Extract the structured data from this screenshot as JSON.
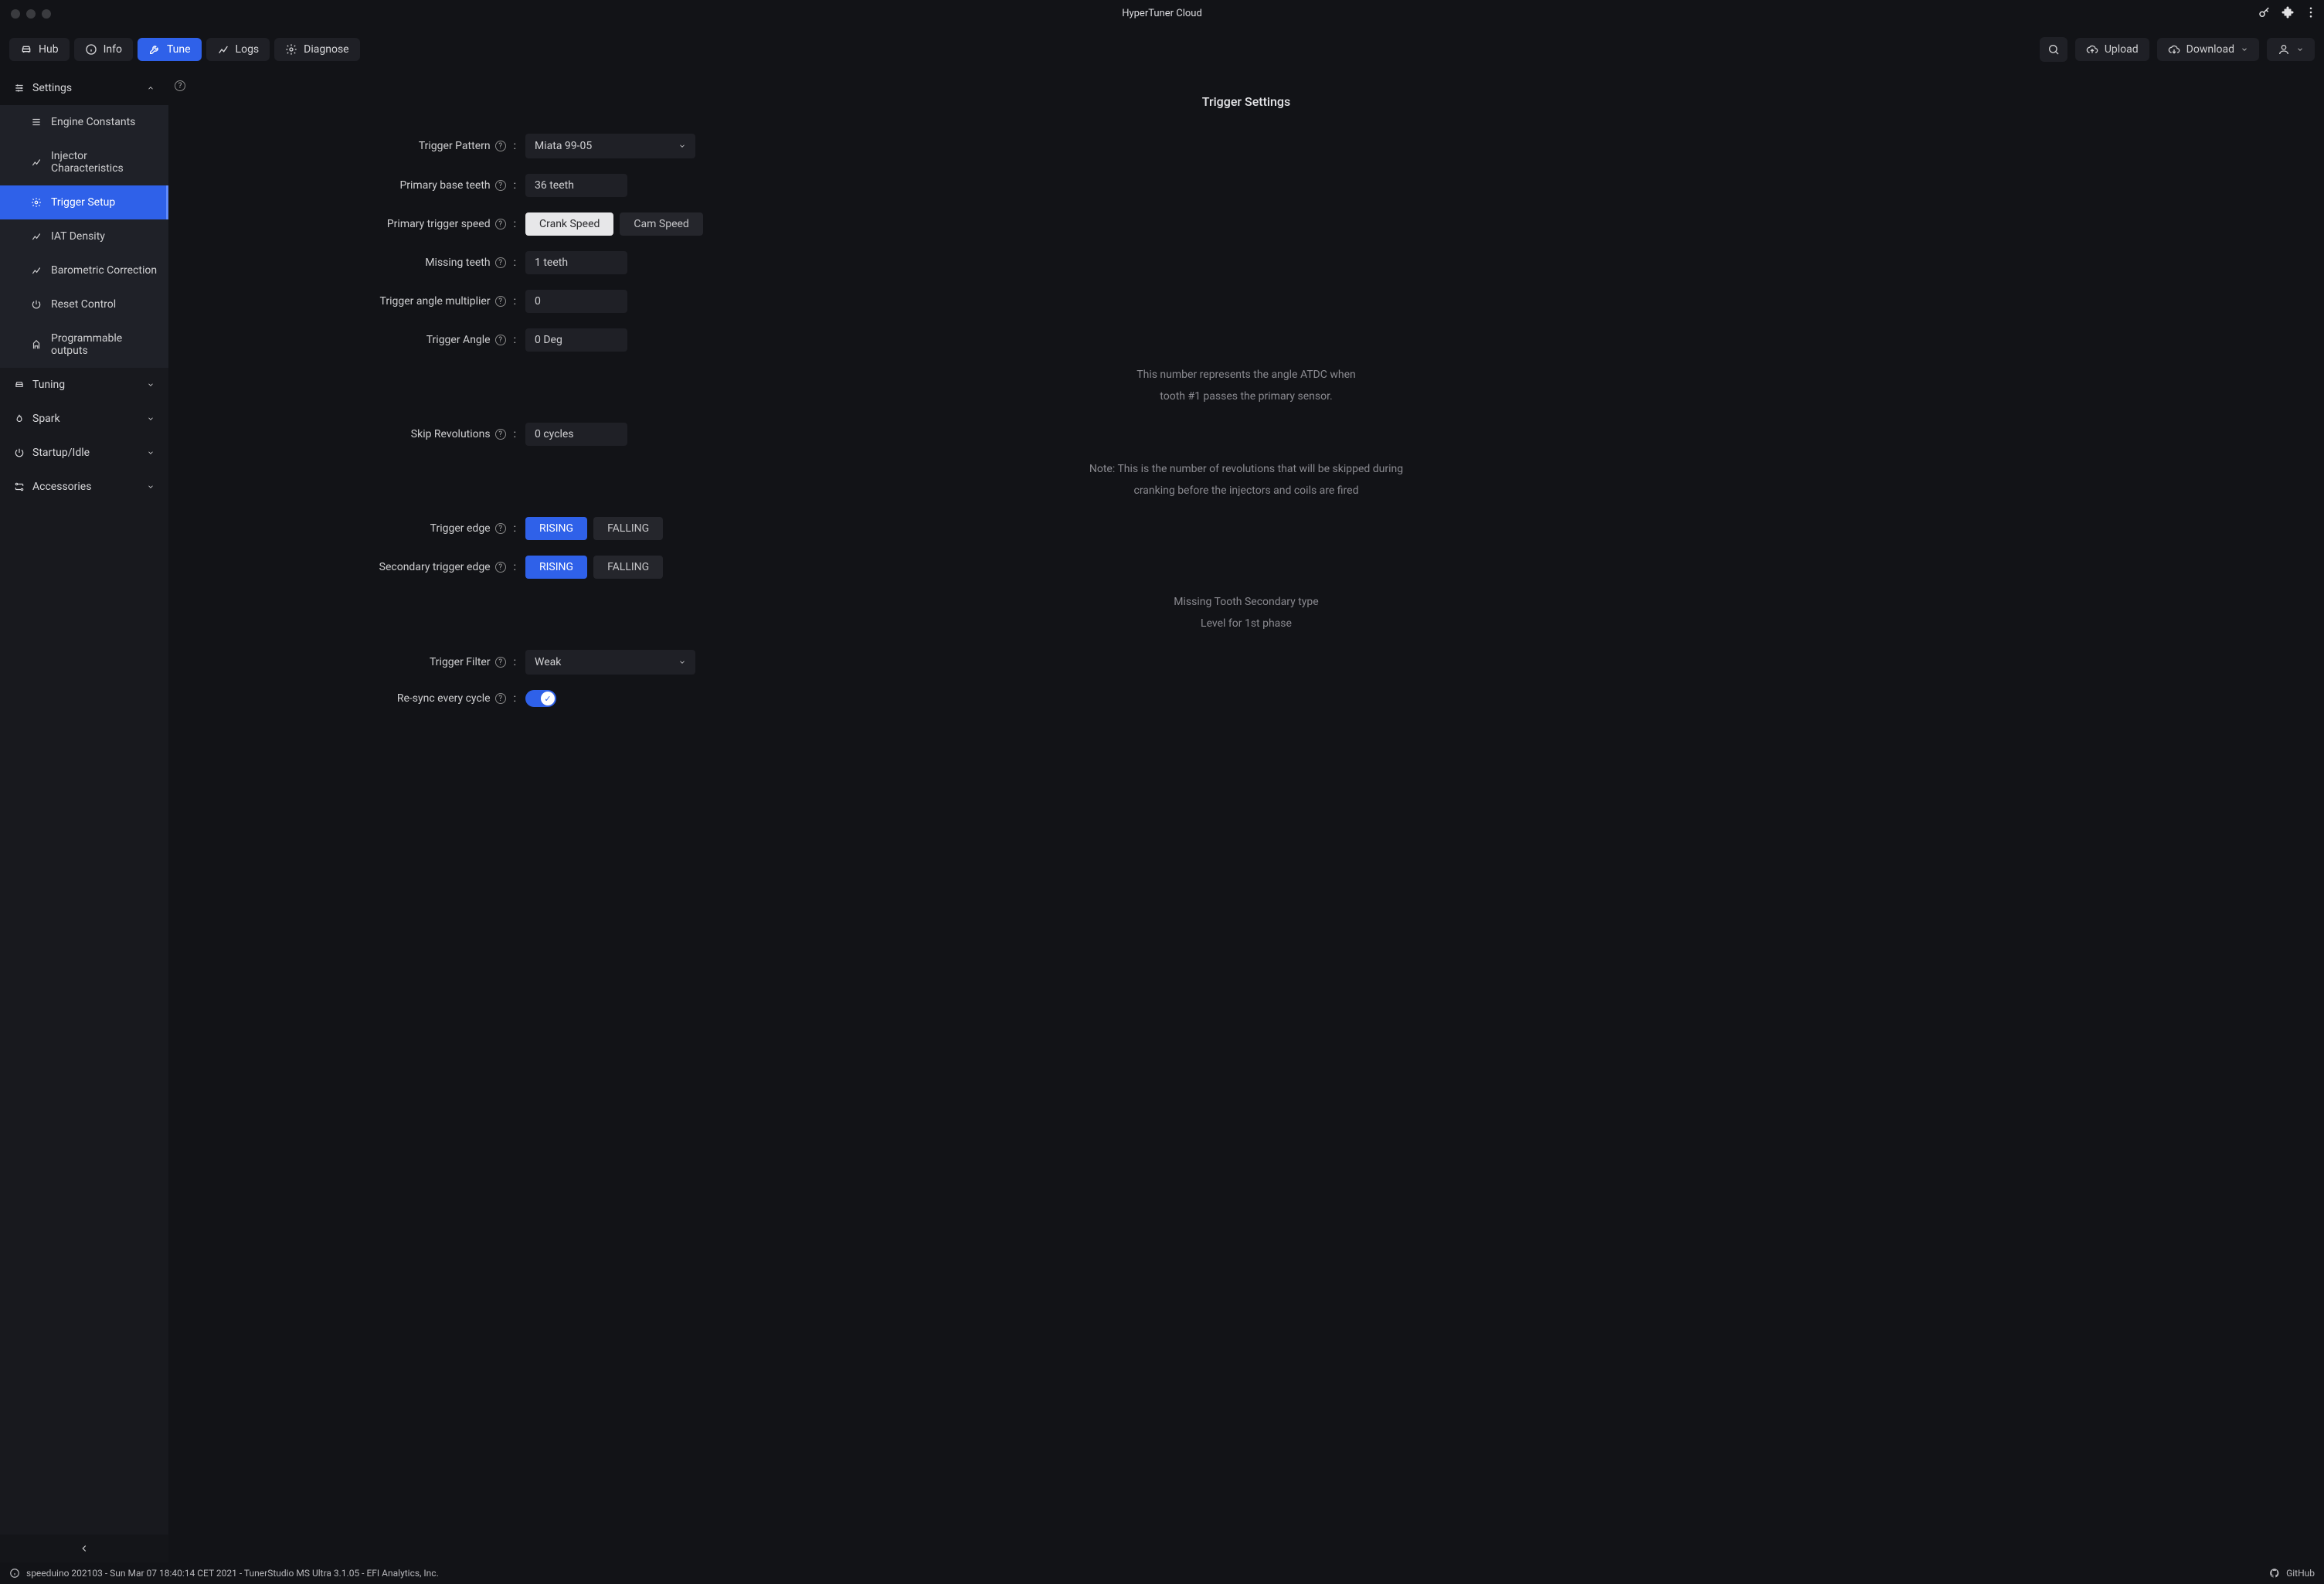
{
  "app_title": "HyperTuner Cloud",
  "nav_tabs": {
    "hub": "Hub",
    "info": "Info",
    "tune": "Tune",
    "logs": "Logs",
    "diagnose": "Diagnose"
  },
  "toolbar": {
    "upload": "Upload",
    "download": "Download"
  },
  "sidebar": {
    "settings": "Settings",
    "engine_constants": "Engine Constants",
    "injector_characteristics": "Injector Characteristics",
    "trigger_setup": "Trigger Setup",
    "iat_density": "IAT Density",
    "barometric_correction": "Barometric Correction",
    "reset_control": "Reset Control",
    "programmable_outputs": "Programmable outputs",
    "tuning": "Tuning",
    "spark": "Spark",
    "startup_idle": "Startup/Idle",
    "accessories": "Accessories"
  },
  "page": {
    "title": "Trigger Settings",
    "rows": {
      "trigger_pattern": {
        "label": "Trigger Pattern",
        "value": "Miata 99-05"
      },
      "primary_base_teeth": {
        "label": "Primary base teeth",
        "value": "36 teeth"
      },
      "primary_trigger_speed": {
        "label": "Primary trigger speed",
        "opt_a": "Crank Speed",
        "opt_b": "Cam Speed"
      },
      "missing_teeth": {
        "label": "Missing teeth",
        "value": "1 teeth"
      },
      "trigger_angle_multiplier": {
        "label": "Trigger angle multiplier",
        "value": "0"
      },
      "trigger_angle": {
        "label": "Trigger Angle",
        "value": "0 Deg",
        "desc1": "This number represents the angle ATDC when",
        "desc2": "tooth #1 passes the primary sensor."
      },
      "skip_revolutions": {
        "label": "Skip Revolutions",
        "value": "0 cycles",
        "desc1": "Note: This is the number of revolutions that will be skipped during",
        "desc2": "cranking before the injectors and coils are fired"
      },
      "trigger_edge": {
        "label": "Trigger edge",
        "opt_a": "RISING",
        "opt_b": "FALLING"
      },
      "secondary_trigger_edge": {
        "label": "Secondary trigger edge",
        "opt_a": "RISING",
        "opt_b": "FALLING",
        "desc1": "Missing Tooth Secondary type",
        "desc2": "Level for 1st phase"
      },
      "trigger_filter": {
        "label": "Trigger Filter",
        "value": "Weak"
      },
      "resync": {
        "label": "Re-sync every cycle",
        "value_on": true
      }
    }
  },
  "status": {
    "left": "speeduino 202103 - Sun Mar 07 18:40:14 CET 2021 - TunerStudio MS Ultra 3.1.05 - EFI Analytics, Inc.",
    "right": "GitHub"
  }
}
